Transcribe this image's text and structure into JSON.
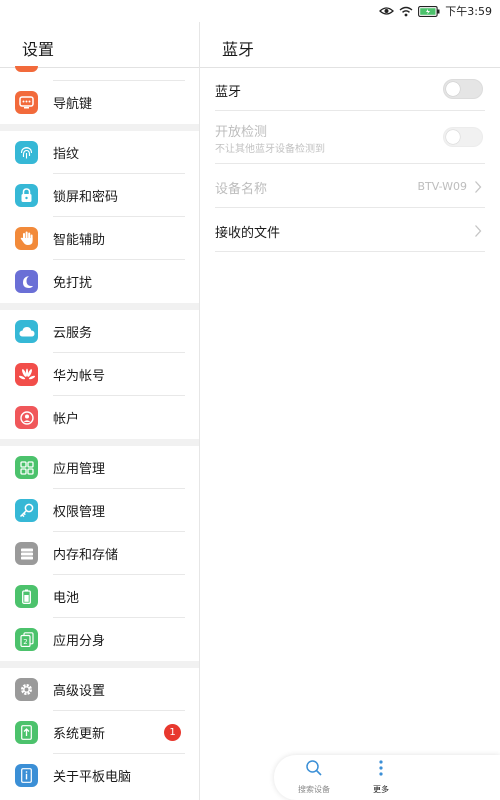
{
  "status_bar": {
    "time": "下午3:59"
  },
  "left_panel": {
    "title": "设置",
    "groups": [
      {
        "items": [
          {
            "label": "导航键",
            "icon": "navigation-key-icon",
            "color": "#f26a3b"
          }
        ]
      },
      {
        "items": [
          {
            "label": "指纹",
            "icon": "fingerprint-icon",
            "color": "#36b8d6"
          },
          {
            "label": "锁屏和密码",
            "icon": "lock-icon",
            "color": "#36b8d6"
          },
          {
            "label": "智能辅助",
            "icon": "hand-icon",
            "color": "#f28a3a"
          },
          {
            "label": "免打扰",
            "icon": "moon-icon",
            "color": "#6a6fd6"
          }
        ]
      },
      {
        "items": [
          {
            "label": "云服务",
            "icon": "cloud-icon",
            "color": "#36b8d6"
          },
          {
            "label": "华为帐号",
            "icon": "huawei-logo-icon",
            "color": "#f24e4a"
          },
          {
            "label": "帐户",
            "icon": "account-icon",
            "color": "#f0575a"
          }
        ]
      },
      {
        "items": [
          {
            "label": "应用管理",
            "icon": "apps-grid-icon",
            "color": "#4cc26c"
          },
          {
            "label": "权限管理",
            "icon": "key-icon",
            "color": "#36b8d6"
          },
          {
            "label": "内存和存储",
            "icon": "storage-icon",
            "color": "#9a9a9a"
          },
          {
            "label": "电池",
            "icon": "battery-icon",
            "color": "#4cc26c"
          },
          {
            "label": "应用分身",
            "icon": "app-twin-icon",
            "color": "#4cc26c"
          }
        ]
      },
      {
        "items": [
          {
            "label": "高级设置",
            "icon": "gear-icon",
            "color": "#9a9a9a"
          },
          {
            "label": "系统更新",
            "icon": "system-update-icon",
            "color": "#4cc26c",
            "badge": "1"
          },
          {
            "label": "关于平板电脑",
            "icon": "info-icon",
            "color": "#3b8fd6"
          }
        ]
      }
    ]
  },
  "right_panel": {
    "title": "蓝牙",
    "rows": {
      "bluetooth": {
        "label": "蓝牙",
        "enabled": false
      },
      "discoverable": {
        "label": "开放检测",
        "sublabel": "不让其他蓝牙设备检测到",
        "enabled": false
      },
      "device_name": {
        "label": "设备名称",
        "value": "BTV-W09"
      },
      "received_files": {
        "label": "接收的文件"
      }
    }
  },
  "bottom_bar": {
    "search_label": "搜索设备",
    "more_label": "更多",
    "accent_color": "#3b8fd6"
  }
}
